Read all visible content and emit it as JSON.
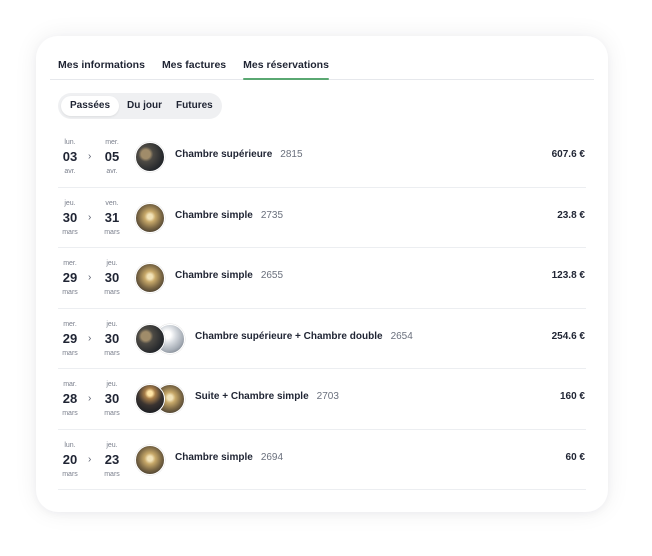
{
  "tabs": [
    {
      "label": "Mes informations",
      "active": false
    },
    {
      "label": "Mes factures",
      "active": false
    },
    {
      "label": "Mes réservations",
      "active": true
    }
  ],
  "filters": [
    {
      "label": "Passées",
      "active": true
    },
    {
      "label": "Du jour",
      "active": false
    },
    {
      "label": "Futures",
      "active": false
    }
  ],
  "arrow": "›",
  "reservations": [
    {
      "from": {
        "dow": "lun.",
        "day": "03",
        "mon": "avr."
      },
      "to": {
        "dow": "mer.",
        "day": "05",
        "mon": "avr."
      },
      "images": [
        "img-dark"
      ],
      "name": "Chambre supérieure",
      "ref": "2815",
      "price": "607.6 €"
    },
    {
      "from": {
        "dow": "jeu.",
        "day": "30",
        "mon": "mars"
      },
      "to": {
        "dow": "ven.",
        "day": "31",
        "mon": "mars"
      },
      "images": [
        "img-gold"
      ],
      "name": "Chambre simple",
      "ref": "2735",
      "price": "23.8 €"
    },
    {
      "from": {
        "dow": "mer.",
        "day": "29",
        "mon": "mars"
      },
      "to": {
        "dow": "jeu.",
        "day": "30",
        "mon": "mars"
      },
      "images": [
        "img-gold"
      ],
      "name": "Chambre simple",
      "ref": "2655",
      "price": "123.8 €"
    },
    {
      "from": {
        "dow": "mer.",
        "day": "29",
        "mon": "mars"
      },
      "to": {
        "dow": "jeu.",
        "day": "30",
        "mon": "mars"
      },
      "images": [
        "img-dark",
        "img-light"
      ],
      "name": "Chambre supérieure + Chambre double",
      "ref": "2654",
      "price": "254.6 €"
    },
    {
      "from": {
        "dow": "mar.",
        "day": "28",
        "mon": "mars"
      },
      "to": {
        "dow": "jeu.",
        "day": "30",
        "mon": "mars"
      },
      "images": [
        "img-lamp",
        "img-gold"
      ],
      "name": "Suite + Chambre simple",
      "ref": "2703",
      "price": "160 €"
    },
    {
      "from": {
        "dow": "lun.",
        "day": "20",
        "mon": "mars"
      },
      "to": {
        "dow": "jeu.",
        "day": "23",
        "mon": "mars"
      },
      "images": [
        "img-gold"
      ],
      "name": "Chambre simple",
      "ref": "2694",
      "price": "60 €"
    }
  ],
  "colors": {
    "accent": "#5aa872",
    "text": "#1f2433",
    "muted": "#7a7f8c",
    "segment_bg": "#eff0f2"
  }
}
